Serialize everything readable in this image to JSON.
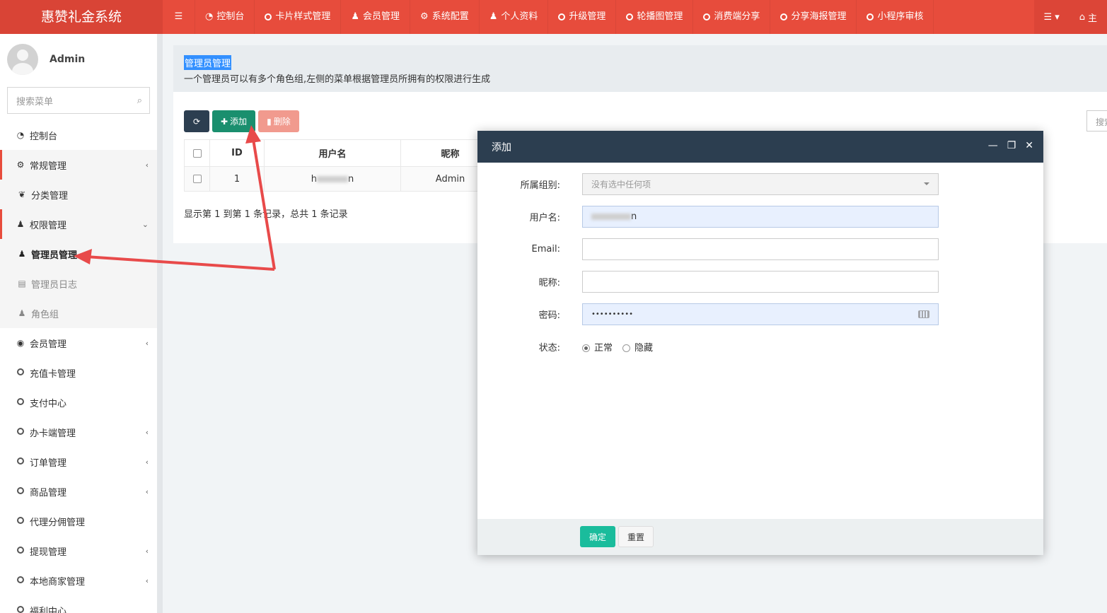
{
  "app": {
    "title": "惠赞礼金系统"
  },
  "topnav": {
    "items": [
      {
        "icon": "dashboard-icon",
        "label": "控制台"
      },
      {
        "icon": "circle-icon",
        "label": "卡片样式管理"
      },
      {
        "icon": "user-icon",
        "label": "会员管理"
      },
      {
        "icon": "gear-icon",
        "label": "系统配置"
      },
      {
        "icon": "user-icon",
        "label": "个人资料"
      },
      {
        "icon": "circle-icon",
        "label": "升级管理"
      },
      {
        "icon": "circle-icon",
        "label": "轮播图管理"
      },
      {
        "icon": "circle-icon",
        "label": "消费端分享"
      },
      {
        "icon": "circle-icon",
        "label": "分享海报管理"
      },
      {
        "icon": "circle-icon",
        "label": "小程序审核"
      }
    ],
    "home_label": "主"
  },
  "sidebar": {
    "user_name": "Admin",
    "search_placeholder": "搜索菜单",
    "items": [
      {
        "icon": "dashboard-icon",
        "label": "控制台"
      },
      {
        "icon": "cogs-icon",
        "label": "常规管理"
      },
      {
        "icon": "leaf-icon",
        "label": "分类管理"
      },
      {
        "icon": "users-icon",
        "label": "权限管理"
      },
      {
        "icon": "user-icon",
        "label": "管理员管理"
      },
      {
        "icon": "list-icon",
        "label": "管理员日志"
      },
      {
        "icon": "users-icon",
        "label": "角色组"
      },
      {
        "icon": "user-circle-icon",
        "label": "会员管理"
      },
      {
        "icon": "circle-icon",
        "label": "充值卡管理"
      },
      {
        "icon": "circle-icon",
        "label": "支付中心"
      },
      {
        "icon": "circle-icon",
        "label": "办卡端管理"
      },
      {
        "icon": "circle-icon",
        "label": "订单管理"
      },
      {
        "icon": "circle-icon",
        "label": "商品管理"
      },
      {
        "icon": "circle-icon",
        "label": "代理分佣管理"
      },
      {
        "icon": "circle-icon",
        "label": "提现管理"
      },
      {
        "icon": "circle-icon",
        "label": "本地商家管理"
      },
      {
        "icon": "circle-icon",
        "label": "福利中心"
      }
    ]
  },
  "page": {
    "title": "管理员管理",
    "description": "一个管理员可以有多个角色组,左侧的菜单根据管理员所拥有的权限进行生成",
    "toolbar": {
      "add_label": "添加",
      "delete_label": "删除"
    },
    "search_placeholder": "搜索",
    "table": {
      "columns": [
        "ID",
        "用户名",
        "昵称"
      ],
      "rows": [
        {
          "id": "1",
          "username_start": "h",
          "username_end": "n",
          "nickname": "Admin",
          "edge": "20"
        }
      ]
    },
    "record_info": "显示第 1 到第 1 条记录，总共 1 条记录"
  },
  "modal": {
    "title": "添加",
    "fields": {
      "group_label": "所属组别:",
      "group_placeholder": "没有选中任何项",
      "username_label": "用户名:",
      "username_value_end": "n",
      "email_label": "Email:",
      "nickname_label": "昵称:",
      "password_label": "密码:",
      "password_value": "••••••••••",
      "status_label": "状态:",
      "status_options": [
        "正常",
        "隐藏"
      ],
      "status_selected": "正常"
    },
    "ok_label": "确定",
    "reset_label": "重置"
  },
  "colors": {
    "brand": "#e74c3c",
    "dark": "#2c3e50",
    "success": "#1abc9c"
  }
}
